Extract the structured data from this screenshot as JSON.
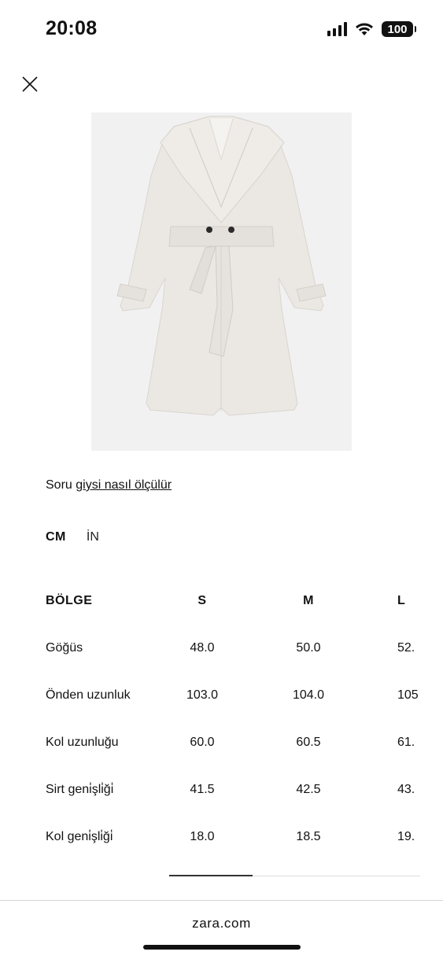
{
  "status_bar": {
    "time": "20:08",
    "battery": "100",
    "icons": [
      "cellular-signal-icon",
      "wifi-icon",
      "battery-icon"
    ]
  },
  "modal": {
    "close_icon": "close-icon"
  },
  "product_image": {
    "alt": "white-belted-wrap-coat"
  },
  "guide": {
    "prefix": "Soru",
    "link": "giysi nasıl ölçülür"
  },
  "units": {
    "tabs": [
      "CM",
      "İN"
    ],
    "selected": "CM"
  },
  "size_table": {
    "headers": [
      "BÖLGE",
      "S",
      "M",
      "L"
    ],
    "rows": [
      [
        "Göğüs",
        "48.0",
        "50.0",
        "52."
      ],
      [
        "Önden uzunluk",
        "103.0",
        "104.0",
        "105"
      ],
      [
        "Kol uzunluğu",
        "60.0",
        "60.5",
        "61."
      ],
      [
        "Sirt geni̇şli̇ği̇",
        "41.5",
        "42.5",
        "43."
      ],
      [
        "Kol geni̇şli̇ği̇",
        "18.0",
        "18.5",
        "19."
      ]
    ]
  },
  "browser": {
    "url": "zara.com"
  },
  "colors": {
    "text": "#111111",
    "image_background": "#f2f1f2",
    "coat": "#ebe8e4",
    "divider": "#d6d6d6"
  }
}
